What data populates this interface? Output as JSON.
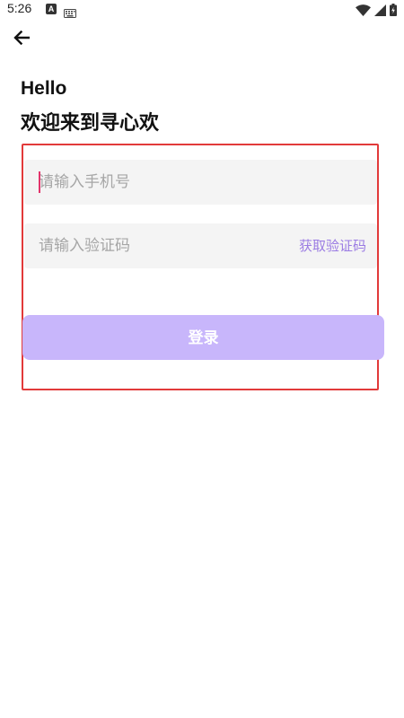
{
  "status_bar": {
    "time": "5:26",
    "notification_icon": "a-notification-icon",
    "keyboard_icon": "keyboard-icon",
    "wifi_icon": "wifi-icon",
    "signal_icon": "signal-icon",
    "battery_icon": "battery-icon",
    "a_label": "A"
  },
  "header": {
    "back_icon": "arrow-left-icon"
  },
  "heading": {
    "greeting": "Hello",
    "welcome": "欢迎来到寻心欢"
  },
  "form": {
    "phone_placeholder": "请输入手机号",
    "phone_value": "",
    "code_placeholder": "请输入验证码",
    "code_value": "",
    "get_code_label": "获取验证码",
    "login_label": "登录"
  },
  "colors": {
    "accent": "#9b7ce3",
    "login_button": "#c8b6fb",
    "input_bg": "#f4f4f4",
    "highlight": "#e23a3a",
    "cursor": "#e2346b"
  }
}
